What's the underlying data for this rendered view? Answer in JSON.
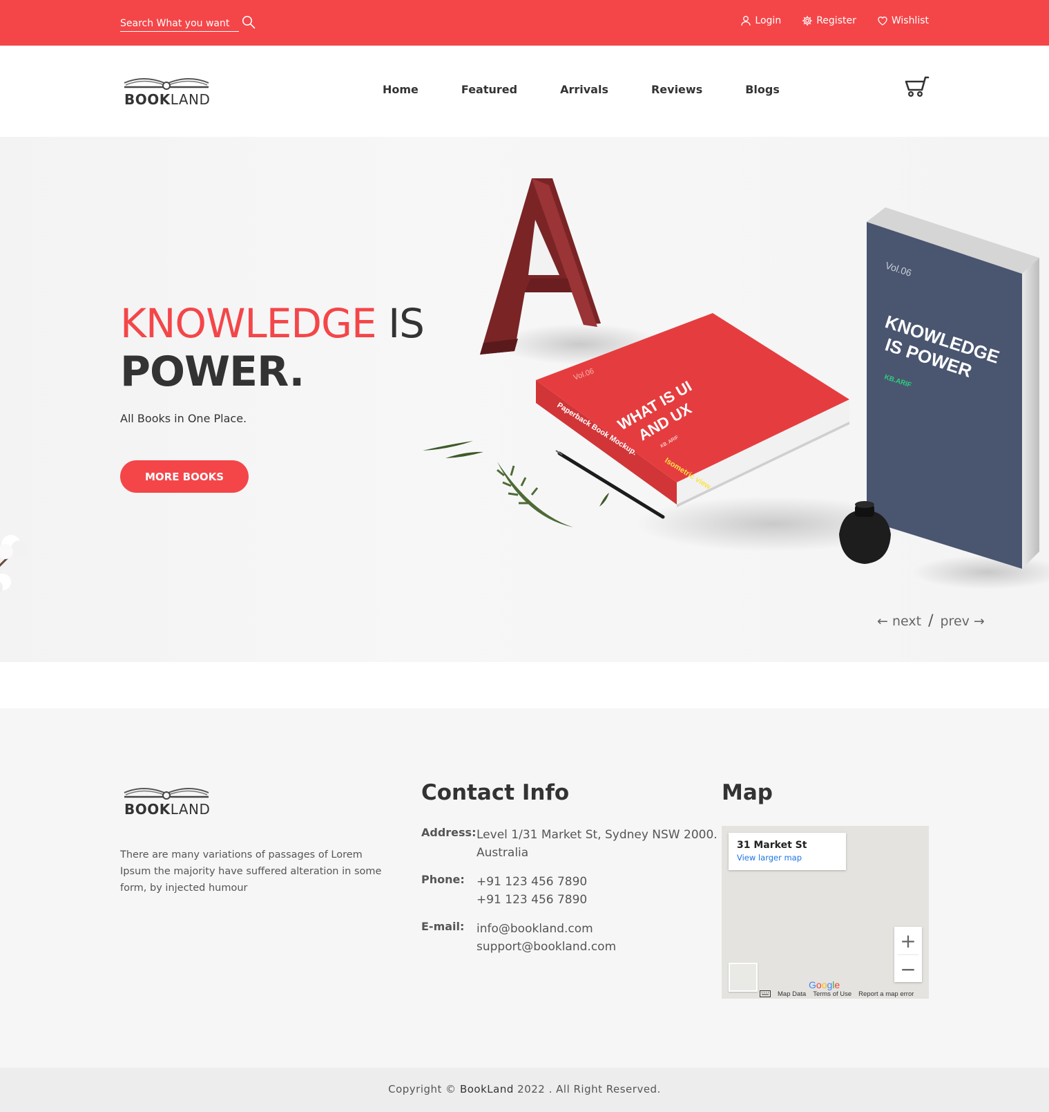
{
  "topbar": {
    "search_placeholder": "Search What you want",
    "links": [
      {
        "label": "Login",
        "icon": "user-icon"
      },
      {
        "label": "Register",
        "icon": "gear-icon"
      },
      {
        "label": "Wishlist",
        "icon": "heart-icon"
      }
    ]
  },
  "header": {
    "logo_bold": "BOOK",
    "logo_light": "LAND",
    "nav": [
      "Home",
      "Featured",
      "Arrivals",
      "Reviews",
      "Blogs"
    ],
    "cart_icon": "cart-icon"
  },
  "hero": {
    "title_accent": "KNOWLEDGE",
    "title_rest": " IS",
    "title_line2": "POWER.",
    "subtitle": "All Books in One Place.",
    "button": "MORE BOOKS",
    "book_red_vol": "Vol.06",
    "book_red_title1": "WHAT IS UI",
    "book_red_title2": "AND UX",
    "book_red_author": "KB. ARIF",
    "book_red_spine": "Paperback Book Mockup.",
    "book_red_view": "Isometric view",
    "book_blue_vol": "Vol.06",
    "book_blue_title1": "KNOWLEDGE",
    "book_blue_title2": "IS POWER",
    "book_blue_author": "KB.ARIF",
    "letter": "A",
    "next": "next",
    "separator": "/",
    "prev": "prev"
  },
  "footer": {
    "logo_bold": "BOOK",
    "logo_light": "LAND",
    "description": "There are many variations of passages of Lorem Ipsum the majority have suffered alteration in some form, by injected humour",
    "contact_heading": "Contact Info",
    "address_label": "Address:",
    "address_line1": "Level 1/31 Market St, Sydney NSW 2000.",
    "address_line2": "Australia",
    "phone_label": "Phone:",
    "phone1": "+91 123 456 7890",
    "phone2": "+91 123 456 7890",
    "email_label": "E-mail:",
    "email1": "info@bookland.com",
    "email2": "support@bookland.com",
    "map_heading": "Map",
    "map_place": "31 Market St",
    "map_link": "View larger map",
    "map_zoom_in": "+",
    "map_zoom_out": "−",
    "map_data": "Map Data",
    "map_terms": "Terms of Use",
    "map_report": "Report a map error",
    "google": "Google"
  },
  "copyright": {
    "prefix": "Copyright © ",
    "brand": "BookLand",
    "suffix": " 2022 . All Right Reserved."
  },
  "colors": {
    "accent": "#f44649",
    "dark_text": "#333333",
    "book_blue": "#4a5670",
    "letter_red": "#8e2b2d"
  }
}
